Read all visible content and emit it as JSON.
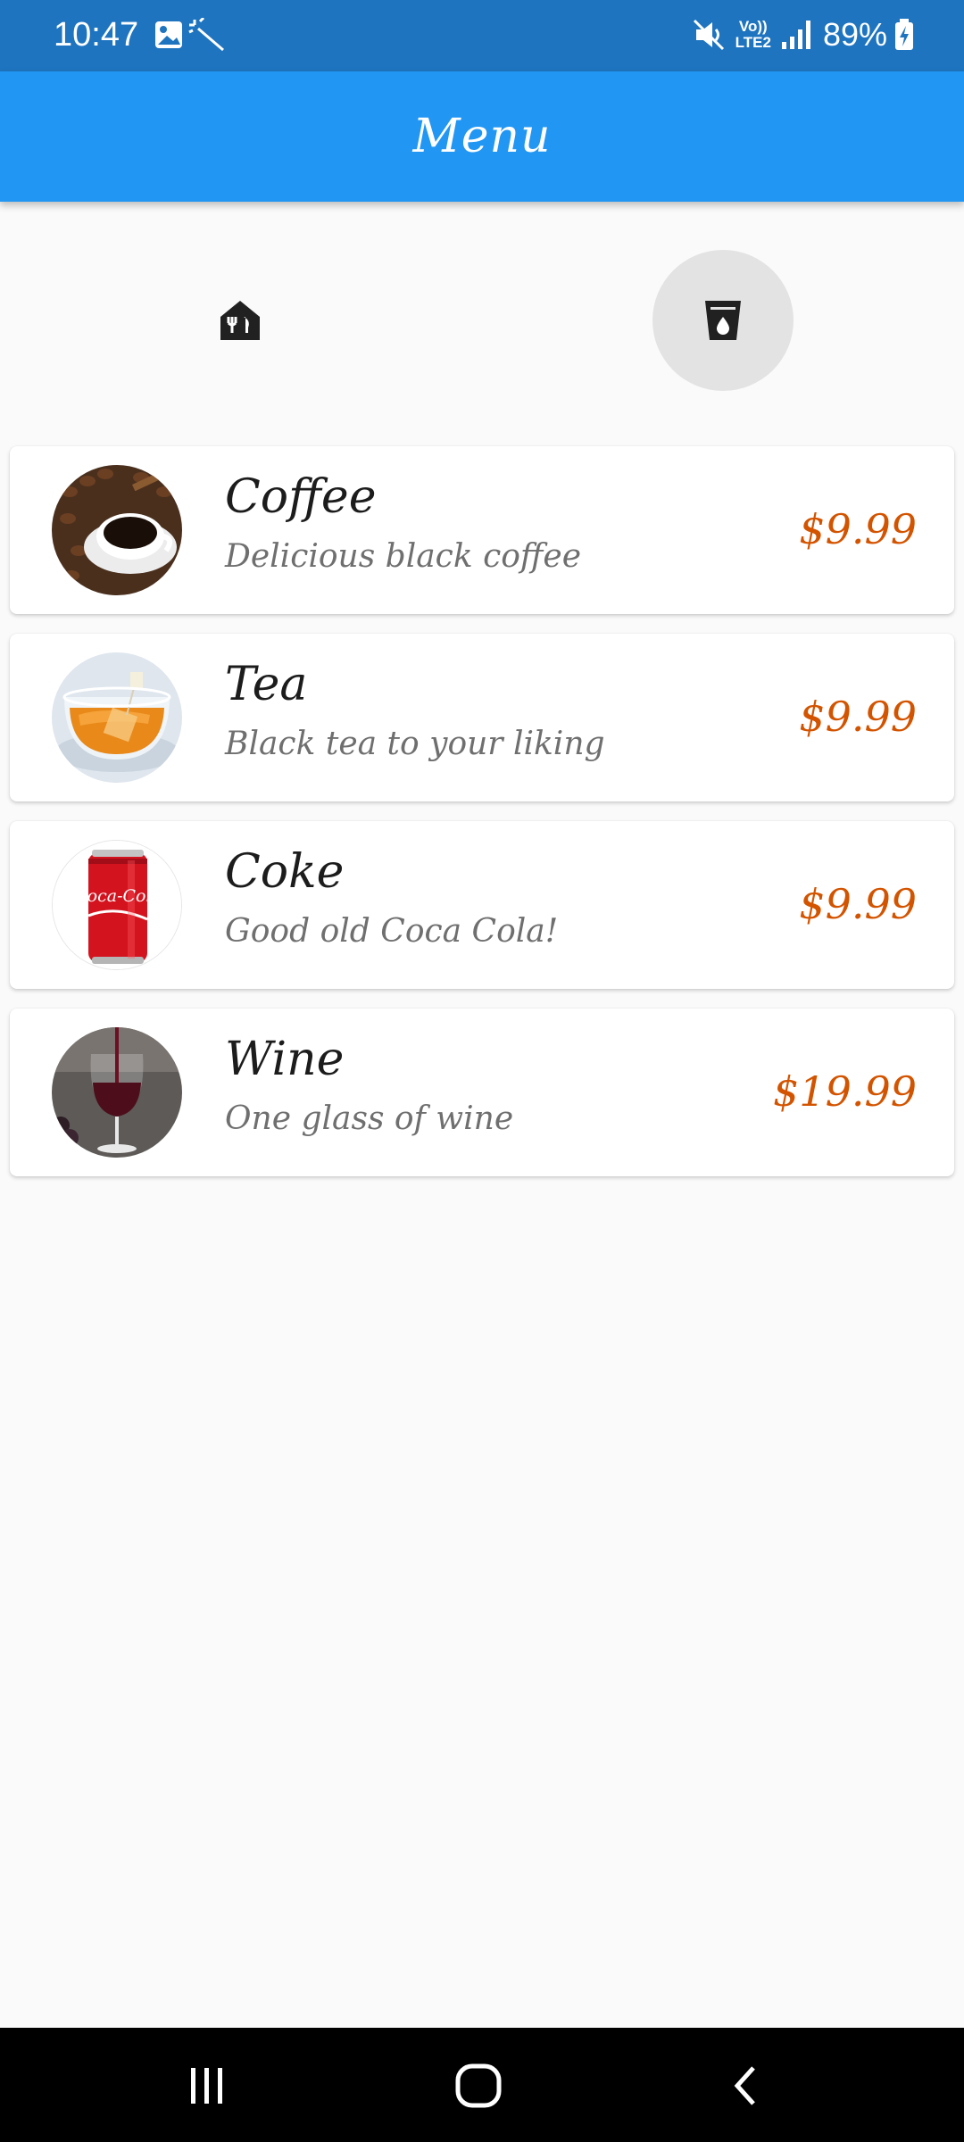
{
  "status_bar": {
    "time": "10:47",
    "battery": "89%",
    "icons_left": [
      "image-icon",
      "magic-wand-icon"
    ],
    "icons_right": [
      "mute-icon",
      "volte-icon",
      "signal-icon",
      "battery-icon"
    ],
    "volte_line1": "Vo))",
    "volte_line2": "LTE2"
  },
  "app_bar": {
    "title": "Menu",
    "color": "#2196f3"
  },
  "categories": [
    {
      "icon": "restaurant-icon",
      "selected": false
    },
    {
      "icon": "drink-icon",
      "selected": true
    }
  ],
  "menu_items": [
    {
      "name": "Coffee",
      "description": "Delicious black coffee",
      "price": "$9.99",
      "image": "coffee-image"
    },
    {
      "name": "Tea",
      "description": "Black tea to your liking",
      "price": "$9.99",
      "image": "tea-image"
    },
    {
      "name": "Coke",
      "description": "Good old Coca Cola!",
      "price": "$9.99",
      "image": "coke-image",
      "image_text": "Coca-Cola"
    },
    {
      "name": "Wine",
      "description": "One glass of wine",
      "price": "$19.99",
      "image": "wine-image"
    }
  ],
  "colors": {
    "price": "#d35400",
    "status_bar": "#1e74bf",
    "background": "#fafafa"
  },
  "nav_bar": {
    "buttons": [
      "recents-icon",
      "home-icon",
      "back-icon"
    ]
  }
}
